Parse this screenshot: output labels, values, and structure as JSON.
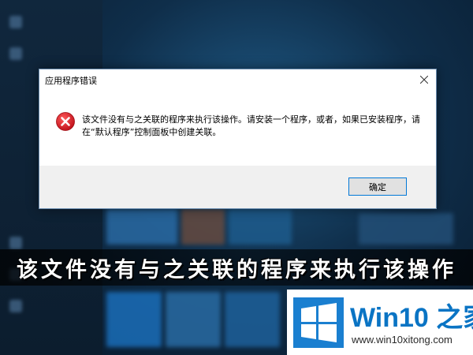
{
  "dialog": {
    "title": "应用程序错误",
    "message": "该文件没有与之关联的程序来执行该操作。请安装一个程序，或者，如果已安装程序，请在“默认程序”控制面板中创建关联。",
    "ok_label": "确定",
    "icon": "error-icon",
    "close_icon": "close-icon"
  },
  "banner": {
    "text": "该文件没有与之关联的程序来执行该操作"
  },
  "brand": {
    "name": "Win10 之家",
    "url": "www.win10xitong.com",
    "logo_icon": "windows-logo-icon",
    "color": "#0a74c4"
  },
  "colors": {
    "error_red": "#e81123",
    "ok_border": "#0078d7",
    "desktop": "#0f2e4a"
  }
}
